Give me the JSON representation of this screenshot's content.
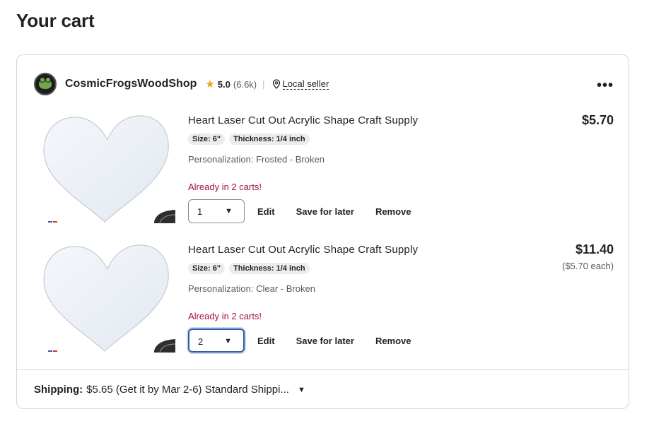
{
  "page": {
    "title": "Your cart"
  },
  "shop": {
    "name": "CosmicFrogsWoodShop",
    "rating": "5.0",
    "rating_count": "(6.6k)",
    "separator": "|",
    "local_seller": "Local seller",
    "star_color": "#f1a10d"
  },
  "items": [
    {
      "title": "Heart Laser Cut Out Acrylic Shape Craft Supply",
      "chips": [
        "Size: 6\"",
        "Thickness: 1/4 inch"
      ],
      "personalization": "Personalization: Frosted - Broken",
      "alert": "Already in 2 carts!",
      "quantity": "1",
      "price": "$5.70",
      "each": "",
      "actions": {
        "edit": "Edit",
        "save": "Save for later",
        "remove": "Remove"
      }
    },
    {
      "title": "Heart Laser Cut Out Acrylic Shape Craft Supply",
      "chips": [
        "Size: 6\"",
        "Thickness: 1/4 inch"
      ],
      "personalization": "Personalization: Clear - Broken",
      "alert": "Already in 2 carts!",
      "quantity": "2",
      "price": "$11.40",
      "each": "($5.70 each)",
      "actions": {
        "edit": "Edit",
        "save": "Save for later",
        "remove": "Remove"
      }
    }
  ],
  "shipping": {
    "label": "Shipping:",
    "text": "$5.65 (Get it by Mar 2-6) Standard Shippi..."
  },
  "icons": {
    "star": "star-icon",
    "pin": "map-pin-icon",
    "more": "more-options-icon",
    "caret": "chevron-down-icon"
  },
  "colors": {
    "alert": "#a3123f",
    "focus": "#2b5ea8"
  }
}
